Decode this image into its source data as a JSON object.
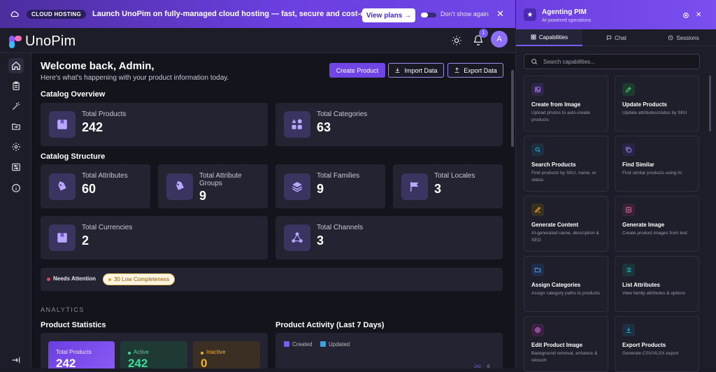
{
  "banner": {
    "pill": "CLOUD HOSTING",
    "message": "Launch UnoPim on fully-managed cloud hosting — fast, secure and cost-effective plans.",
    "view_plans": "View plans →",
    "dont_show": "Don't show again",
    "close": "✕"
  },
  "topbar": {
    "logo": "UnoPim",
    "notifications": "1",
    "avatar": "A"
  },
  "main": {
    "welcome": "Welcome back, Admin,",
    "subtitle": "Here's what's happening with your product information today.",
    "create_product": "Create Product",
    "import_data": "Import Data",
    "export_data": "Export Data",
    "catalog_overview": "Catalog Overview",
    "overview": [
      {
        "label": "Total Products",
        "value": "242"
      },
      {
        "label": "Total Categories",
        "value": "63"
      }
    ],
    "catalog_structure": "Catalog Structure",
    "structure": [
      {
        "label": "Total Attributes",
        "value": "60"
      },
      {
        "label": "Total Attribute Groups",
        "value": "9"
      },
      {
        "label": "Total Families",
        "value": "9"
      },
      {
        "label": "Total Locales",
        "value": "3"
      },
      {
        "label": "Total Currencies",
        "value": "2"
      },
      {
        "label": "Total Channels",
        "value": "3"
      }
    ],
    "needs_attention": "Needs Attention",
    "low_completeness": "30 Low Completeness",
    "analytics": "ANALYTICS",
    "product_statistics": "Product Statistics",
    "product_activity": "Product Activity (Last 7 Days)",
    "stats": [
      {
        "label": "Total Products",
        "value": "242"
      },
      {
        "label": "Active",
        "value": "242"
      },
      {
        "label": "Inactive",
        "value": "0"
      }
    ],
    "legend": [
      {
        "name": "Created",
        "color": "#7b5cf0"
      },
      {
        "name": "Updated",
        "color": "#3aa0e0"
      }
    ],
    "chart_tick": "242",
    "chart_tick2": "0"
  },
  "panel": {
    "title": "Agenting PIM",
    "subtitle": "AI-powered operations",
    "tabs": [
      "Capabilities",
      "Chat",
      "Sessions"
    ],
    "search_placeholder": "Search capabilities...",
    "capabilities": [
      {
        "title": "Create from Image",
        "desc": "Upload photos to auto-create products",
        "icon": "image-icon"
      },
      {
        "title": "Update Products",
        "desc": "Update attributes/status by SKU",
        "icon": "edit-icon"
      },
      {
        "title": "Search Products",
        "desc": "Find products by SKU, name, or status",
        "icon": "search-icon"
      },
      {
        "title": "Find Similar",
        "desc": "Find similar products using AI",
        "icon": "copy-icon"
      },
      {
        "title": "Generate Content",
        "desc": "AI-generated name, description & SEO",
        "icon": "pen-icon"
      },
      {
        "title": "Generate Image",
        "desc": "Create product images from text",
        "icon": "plus-square-icon"
      },
      {
        "title": "Assign Categories",
        "desc": "Assign category paths to products",
        "icon": "folder-icon"
      },
      {
        "title": "List Attributes",
        "desc": "View family attributes & options",
        "icon": "list-icon"
      },
      {
        "title": "Edit Product Image",
        "desc": "Background removal, enhance & retouch",
        "icon": "target-icon"
      },
      {
        "title": "Export Products",
        "desc": "Generate CSV/XLSX export",
        "icon": "download-icon"
      }
    ]
  }
}
